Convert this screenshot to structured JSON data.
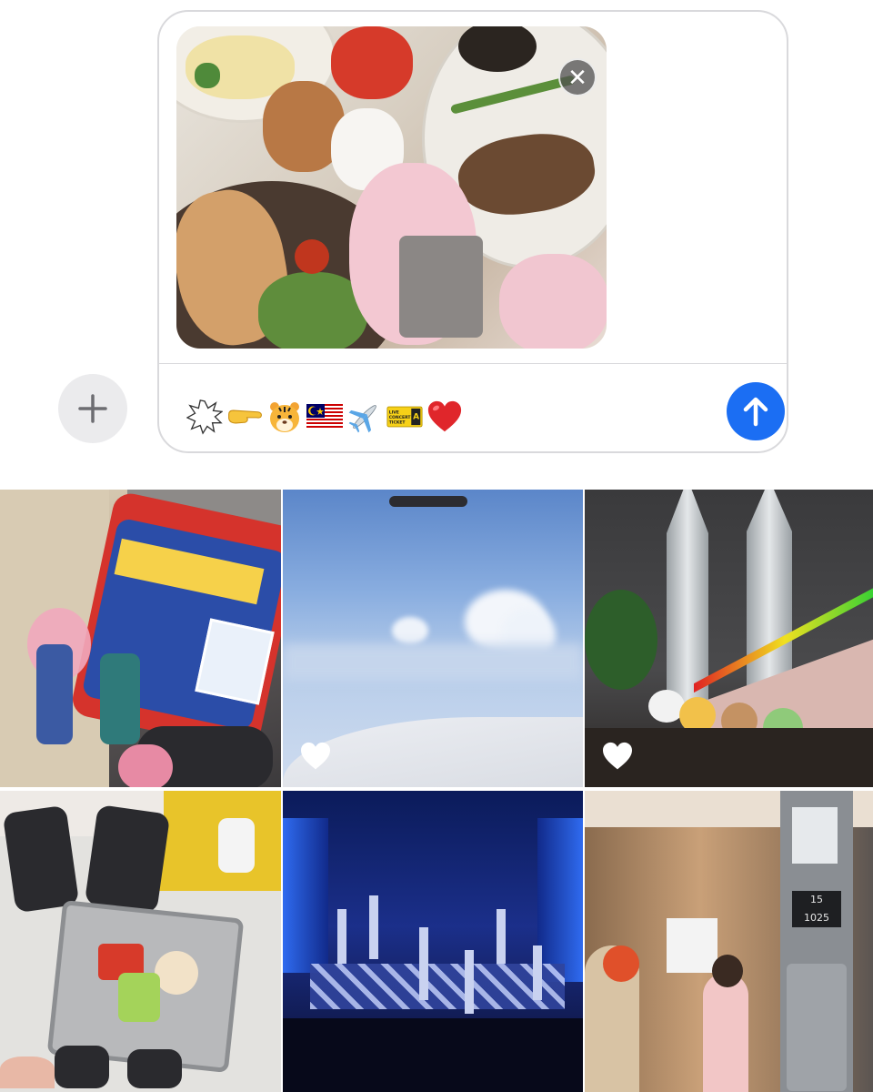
{
  "composer": {
    "remove_symbol": "✕",
    "plus_symbol": "+",
    "send_icon": "arrow-up-icon",
    "attachment_icon": "photo-attachment-thumbnail",
    "emoji": [
      {
        "name": "speech-burst-emoji",
        "glyph": "💥"
      },
      {
        "name": "pointing-hand-emoji",
        "glyph": "👉"
      },
      {
        "name": "tiger-face-emoji",
        "glyph": "🐯"
      },
      {
        "name": "malaysia-flag-emoji",
        "glyph": "🇲🇾"
      },
      {
        "name": "airplane-emoji",
        "glyph": "✈️"
      },
      {
        "name": "concert-ticket-emoji",
        "glyph": "LIVE CONCERT TICKET"
      },
      {
        "name": "red-heart-emoji",
        "glyph": "❤️"
      }
    ],
    "ticket_text": "LIVE CONCERT TICKET",
    "ticket_seat": "A",
    "colors": {
      "send": "#1b6ef3",
      "plus_bg": "#ebebed",
      "border": "#d9d9dc",
      "heart": "#e0262b"
    }
  },
  "grid": {
    "tiles": [
      {
        "name": "photo-keychains"
      },
      {
        "name": "photo-airplane-window-sky",
        "favorite": true
      },
      {
        "name": "photo-petronas-towers",
        "favorite": true
      },
      {
        "name": "photo-shopping-basket"
      },
      {
        "name": "photo-concert-stage"
      },
      {
        "name": "photo-elevator-mirror"
      }
    ],
    "elevator_floor": "15",
    "elevator_label": "1025"
  }
}
